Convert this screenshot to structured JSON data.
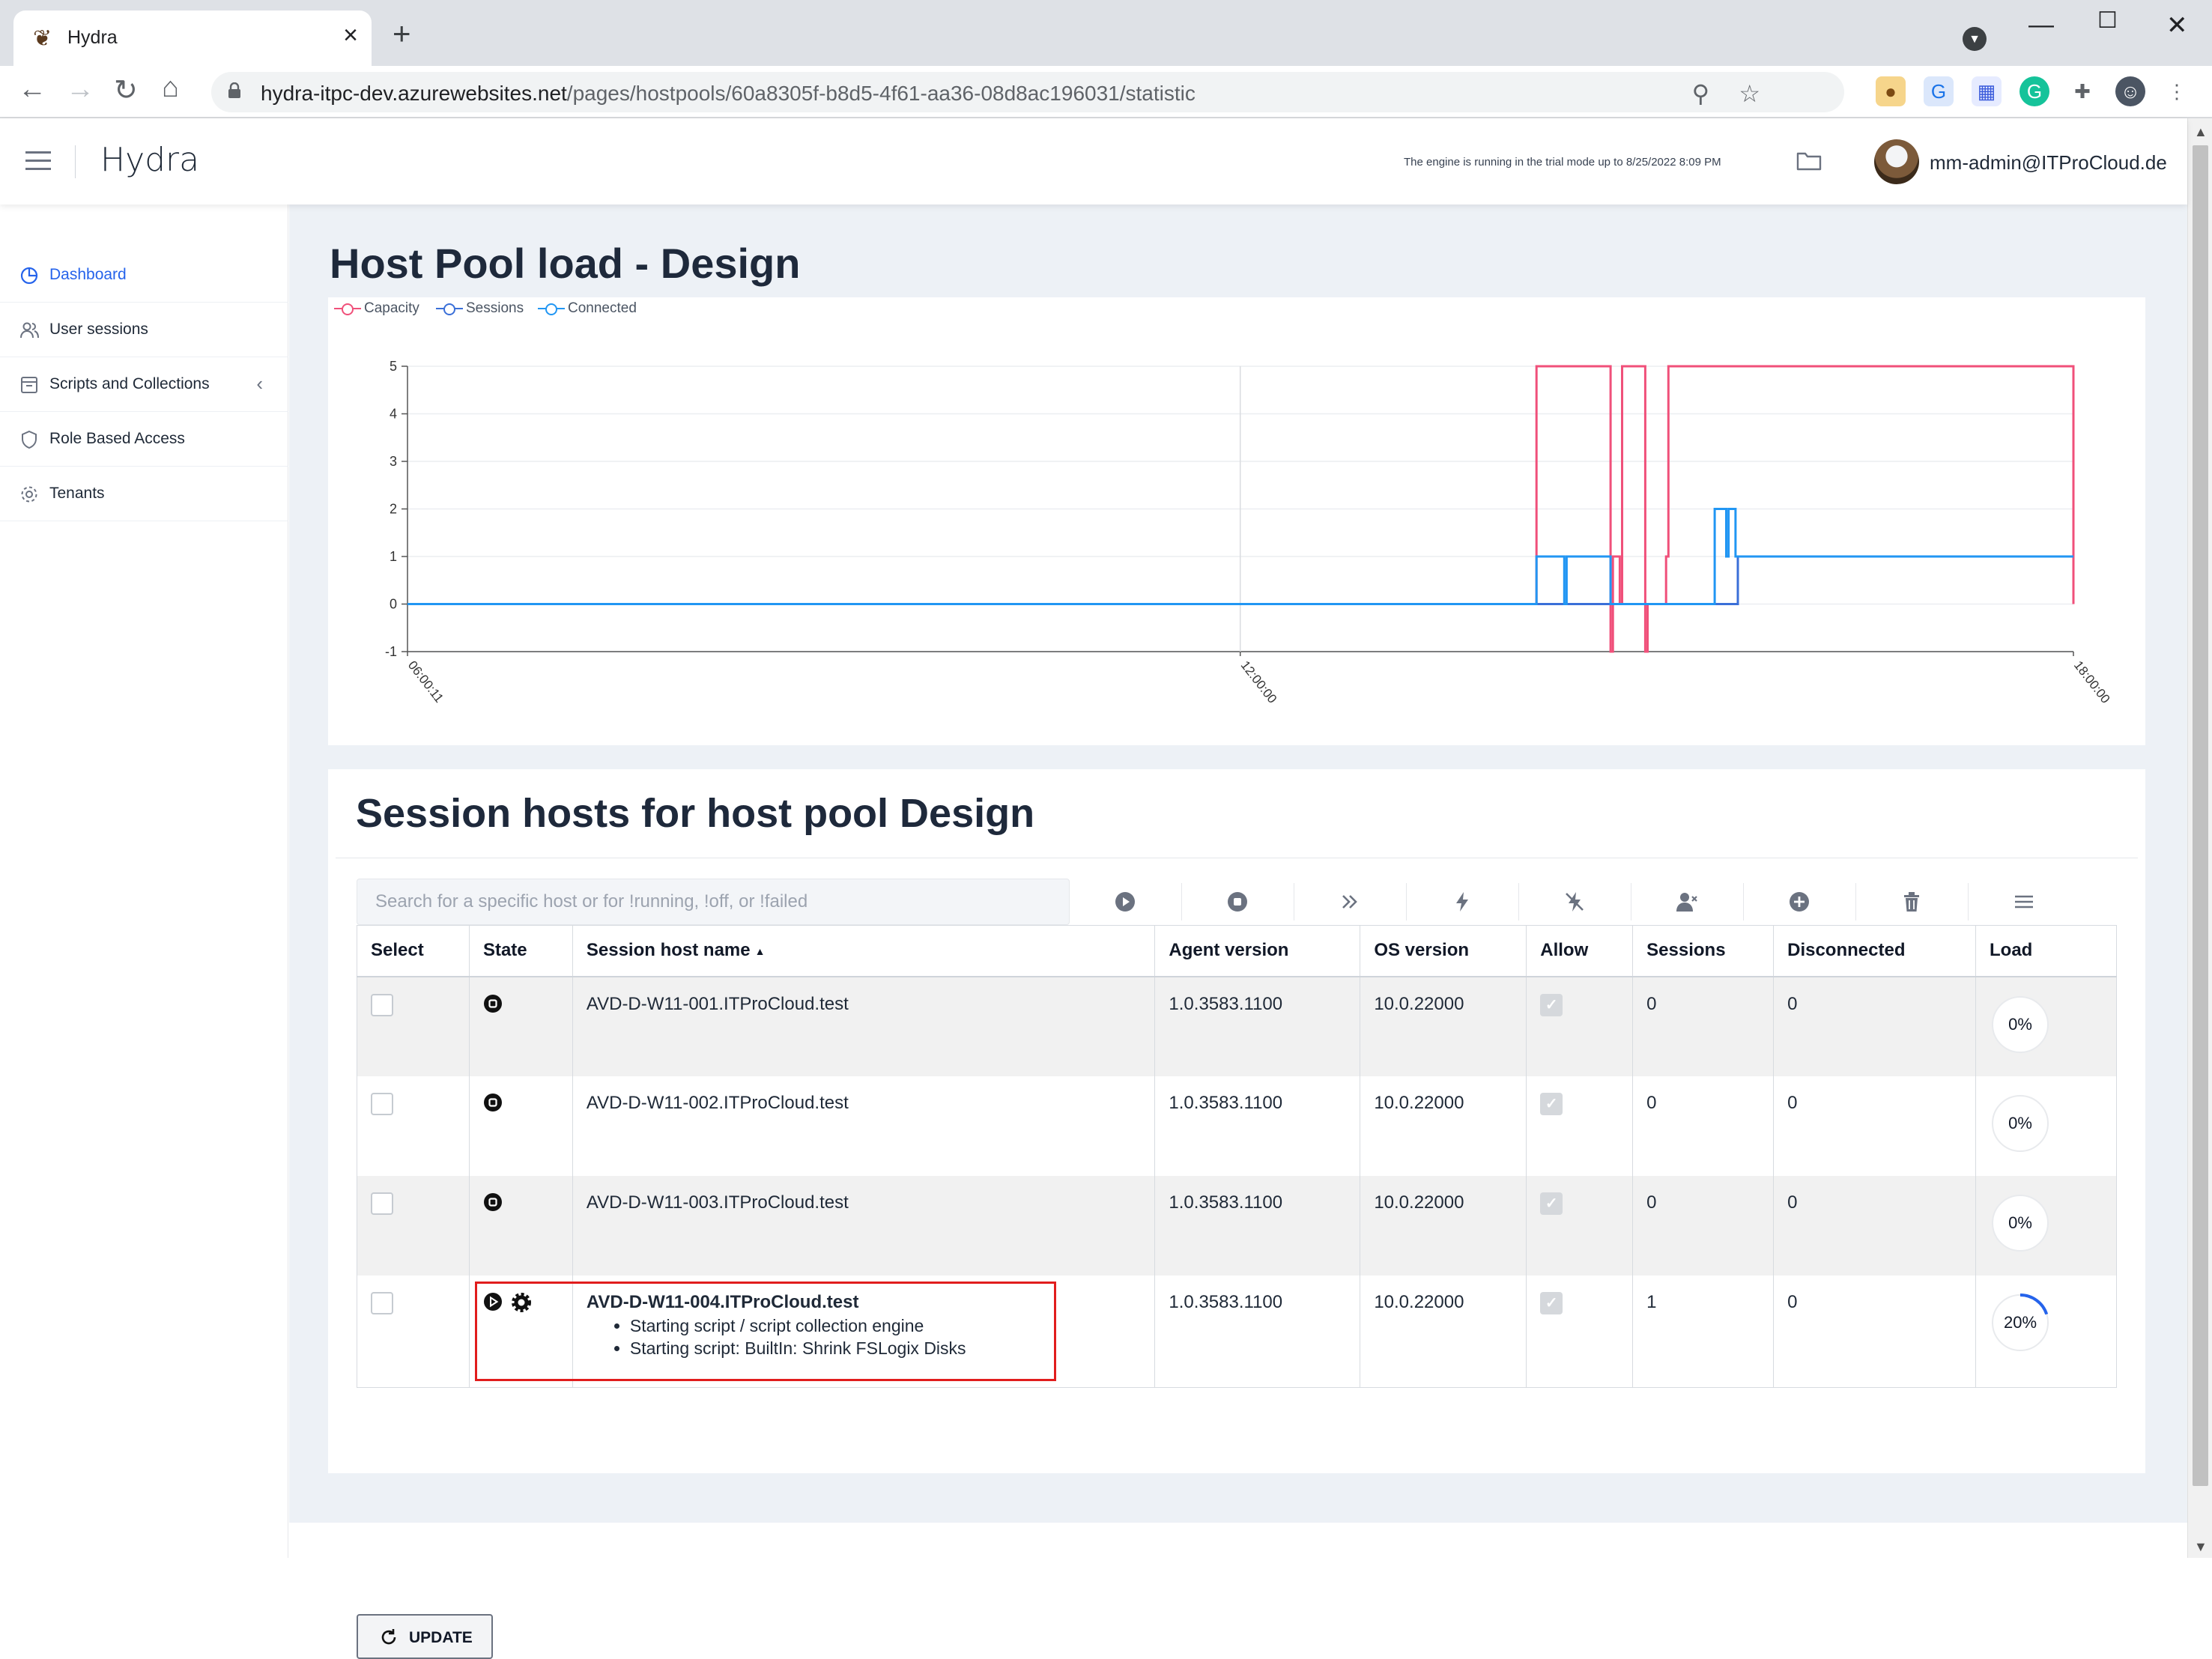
{
  "browser": {
    "tab_title": "Hydra",
    "url_host": "hydra-itpc-dev.azurewebsites.net",
    "url_path": "/pages/hostpools/60a8305f-b8d5-4f61-aa36-08d8ac196031/statistic"
  },
  "header": {
    "app_title": "Hydra",
    "trial_note": "The engine is running in the trial mode up to 8/25/2022 8:09 PM",
    "user": "mm-admin@ITProCloud.de"
  },
  "sidebar": {
    "items": [
      {
        "label": "Dashboard",
        "icon": "pie-chart-icon",
        "active": true
      },
      {
        "label": "User sessions",
        "icon": "users-icon"
      },
      {
        "label": "Scripts and Collections",
        "icon": "archive-icon"
      },
      {
        "label": "Role Based Access",
        "icon": "shield-icon"
      },
      {
        "label": "Tenants",
        "icon": "gear-icon"
      }
    ]
  },
  "page": {
    "title": "Host Pool load - Design"
  },
  "chart_data": {
    "type": "line",
    "title": "",
    "legend": "top-left",
    "grid": true,
    "colors": {
      "Capacity": "#f0507a",
      "Sessions": "#3a6fd8",
      "Connected": "#2196f3"
    },
    "x_ticks": [
      "06:00:11",
      "12:00:00",
      "18:00:00"
    ],
    "xlim": [
      "06:00:11",
      "18:00:00"
    ],
    "ylim": [
      -1,
      5
    ],
    "y_ticks": [
      5,
      4,
      3,
      2,
      1,
      0,
      -1
    ],
    "series": [
      {
        "name": "Capacity",
        "points": [
          [
            "06:00:11",
            0
          ],
          [
            "14:08:00",
            0
          ],
          [
            "14:08:00",
            5
          ],
          [
            "14:40:00",
            5
          ],
          [
            "14:40:00",
            -1
          ],
          [
            "14:41:00",
            -1
          ],
          [
            "14:41:00",
            1
          ],
          [
            "14:44:00",
            1
          ],
          [
            "14:44:00",
            0
          ],
          [
            "14:45:00",
            0
          ],
          [
            "14:45:00",
            5
          ],
          [
            "14:55:00",
            5
          ],
          [
            "14:55:00",
            -1
          ],
          [
            "14:56:00",
            -1
          ],
          [
            "14:56:00",
            0
          ],
          [
            "15:04:00",
            0
          ],
          [
            "15:04:00",
            1
          ],
          [
            "15:05:00",
            1
          ],
          [
            "15:05:00",
            5
          ],
          [
            "18:00:00",
            5
          ],
          [
            "18:00:00",
            0
          ]
        ]
      },
      {
        "name": "Sessions",
        "points": [
          [
            "06:00:11",
            0
          ],
          [
            "15:35:00",
            0
          ],
          [
            "15:35:00",
            1
          ],
          [
            "18:00:00",
            1
          ]
        ]
      },
      {
        "name": "Connected",
        "points": [
          [
            "06:00:11",
            0
          ],
          [
            "14:08:00",
            0
          ],
          [
            "14:08:00",
            1
          ],
          [
            "14:20:00",
            1
          ],
          [
            "14:20:00",
            0
          ],
          [
            "14:21:00",
            0
          ],
          [
            "14:21:00",
            1
          ],
          [
            "14:40:00",
            1
          ],
          [
            "14:40:00",
            0
          ],
          [
            "15:25:00",
            0
          ],
          [
            "15:25:00",
            2
          ],
          [
            "15:30:00",
            2
          ],
          [
            "15:30:00",
            1
          ],
          [
            "15:31:00",
            1
          ],
          [
            "15:31:00",
            2
          ],
          [
            "15:34:00",
            2
          ],
          [
            "15:34:00",
            1
          ],
          [
            "18:00:00",
            1
          ]
        ]
      }
    ]
  },
  "hosts": {
    "title": "Session hosts for host pool Design",
    "search_placeholder": "Search for a specific host or for !running, !off, or !failed",
    "toolbar_actions": [
      "start-icon",
      "stop-icon",
      "forward-icon",
      "bolt-icon",
      "no-bolt-icon",
      "remove-user-icon",
      "add-icon",
      "trash-icon",
      "menu-icon"
    ],
    "columns": [
      "Select",
      "State",
      "Session host name",
      "Agent version",
      "OS version",
      "Allow",
      "Sessions",
      "Disconnected",
      "Load"
    ],
    "rows": [
      {
        "name": "AVD-D-W11-001.ITProCloud.test",
        "agent": "1.0.3583.1100",
        "os": "10.0.22000",
        "sessions": "0",
        "disconnected": "0",
        "load": "0%",
        "load_value": 0
      },
      {
        "name": "AVD-D-W11-002.ITProCloud.test",
        "agent": "1.0.3583.1100",
        "os": "10.0.22000",
        "sessions": "0",
        "disconnected": "0",
        "load": "0%",
        "load_value": 0
      },
      {
        "name": "AVD-D-W11-003.ITProCloud.test",
        "agent": "1.0.3583.1100",
        "os": "10.0.22000",
        "sessions": "0",
        "disconnected": "0",
        "load": "0%",
        "load_value": 0
      },
      {
        "name": "AVD-D-W11-004.ITProCloud.test",
        "agent": "1.0.3583.1100",
        "os": "10.0.22000",
        "sessions": "1",
        "disconnected": "0",
        "load": "20%",
        "load_value": 20,
        "status": [
          "Starting script / script collection engine",
          "Starting script: BuiltIn: Shrink FSLogix Disks"
        ]
      }
    ],
    "update_label": "UPDATE"
  }
}
